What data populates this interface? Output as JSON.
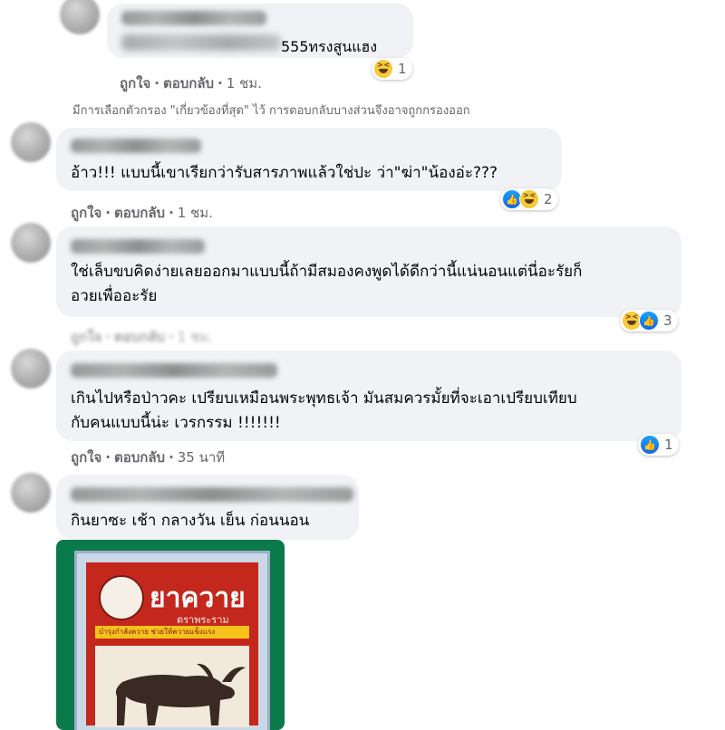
{
  "comments": [
    {
      "text": "555ทรงสูนแฮง",
      "actions": {
        "like": "ถูกใจ",
        "reply": "ตอบกลับ",
        "time": "1 ชม."
      },
      "reactions": {
        "icons": [
          "haha-icon"
        ],
        "count": "1"
      }
    },
    {
      "text": "อ้าว!!! แบบนี้เขาเรียกว่ารับสารภาพแล้วใช่ปะ ว่า\"ฆ่า\"น้องอ่ะ???",
      "actions": {
        "like": "ถูกใจ",
        "reply": "ตอบกลับ",
        "time": "1 ชม."
      },
      "reactions": {
        "icons": [
          "like-icon",
          "haha-icon"
        ],
        "count": "2"
      }
    },
    {
      "text": "ใช่เล็บขบคิดง่ายเลยออกมาแบบนี้ถ้ามีสมองคงพูดได้ดีกว่านี้แน่นอนแต่นี่อะรัยก็\nอวยเพื่ออะรัย",
      "actions": {
        "like": "ถูกใจ",
        "reply": "ตอบกลับ",
        "time": "1 ชม."
      },
      "reactions": {
        "icons": [
          "haha-icon",
          "like-icon"
        ],
        "count": "3"
      }
    },
    {
      "text": "เกินไปหรือป่าวคะ เปรียบเหมือนพระพุทธเจ้า มันสมควรมั้ยที่จะเอาเปรียบเทียบ\nกับคนแบบนี้น่ะ เวรกรรม !!!!!!!",
      "actions": {
        "like": "ถูกใจ",
        "reply": "ตอบกลับ",
        "time": "35 นาที"
      },
      "reactions": {
        "icons": [
          "like-icon"
        ],
        "count": "1"
      }
    },
    {
      "text": "กินยาซะ เช้า กลางวัน เย็น ก่อนนอน"
    }
  ],
  "filter_note": "มีการเลือกตัวกรอง \"เกี่ยวข้องที่สุด\" ไว้ การตอบกลับบางส่วนจึงอาจถูกกรองออก",
  "image": {
    "title": "ยาควาย",
    "subtitle": "ตราพระราม",
    "band_text": "บำรุงกำลังควาย ช่วยให้ควายแข็งแรง"
  },
  "colors": {
    "bubble": "#f0f2f5",
    "meta_text": "#65676b",
    "like_blue": "#1877f2",
    "haha_yellow": "#f7c93b"
  }
}
